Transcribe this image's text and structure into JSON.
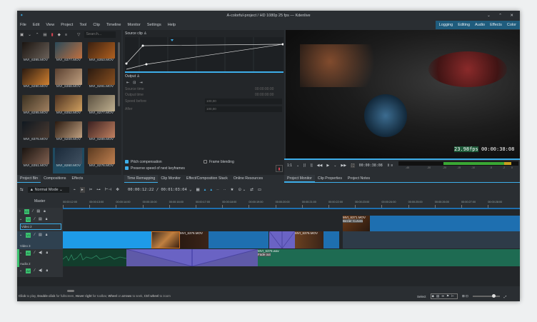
{
  "window": {
    "title": "A-colorful-project / HD 1080p 25 fps — Kdenlive"
  },
  "menu": [
    "File",
    "Edit",
    "View",
    "Project",
    "Tool",
    "Clip",
    "Timeline",
    "Monitor",
    "Settings",
    "Help"
  ],
  "workspaces": [
    "Logging",
    "Editing",
    "Audio",
    "Effects",
    "Color"
  ],
  "bin": {
    "search_placeholder": "Search...",
    "clips": [
      "MVI_6395.MOV",
      "MVI_6377.MOV",
      "MVI_6353.MOV",
      "MVI_6290.MOV",
      "MVI_6368.MOV",
      "MVI_6291.MOV",
      "MVI_6295.MOV",
      "MVI_6352.MOV",
      "MVI_6277.MOV",
      "MVI_6375.MOV",
      "MVI_6269.MOV",
      "MVI_6289.MOV",
      "MVI_6351.MOV",
      "MVI_6260.MOV",
      "MVI_6276.MOV"
    ],
    "selected": "MVI_6260.MOV"
  },
  "remap": {
    "source_clip": "Source clip",
    "output": "Output",
    "source_time_label": "Source time",
    "source_time": "00:00:00:00",
    "output_time_label": "Output time",
    "output_time": "00:00:00:00",
    "speed_before_label": "Speed before",
    "speed_before": "100,00",
    "after_label": "After",
    "after": "100,00",
    "pitch": "Pitch compensation",
    "pitch_checked": true,
    "blending": "Frame blending",
    "blending_checked": false,
    "preserve": "Preserve speed of next keyframes",
    "preserve_checked": true
  },
  "monitor": {
    "overlay_fps": "23.98fps",
    "overlay_tc": "00:00:38:08",
    "zoom": "1:1",
    "timecode": "00:00:38:08",
    "meter_ticks": [
      "-45",
      "-30",
      "-20",
      "-15",
      "-10",
      "-5",
      "-2",
      "0"
    ]
  },
  "left_tabs": [
    "Project Bin",
    "Compositions",
    "Effects"
  ],
  "mid_tabs": [
    "Time Remapping",
    "Clip Monitor",
    "Effect/Composition Stack",
    "Online Resources"
  ],
  "right_tabs": [
    "Project Monitor",
    "Clip Properties",
    "Project Notes"
  ],
  "timeline": {
    "mode": "Normal Mode",
    "position": "00:00:12:22",
    "duration": "00:01:03:04",
    "master": "Master",
    "ruler": [
      "00:00:12:00",
      "00:00:13:00",
      "00:00:14:00",
      "00:00:15:00",
      "00:00:16:00",
      "00:00:17:00",
      "00:00:18:00",
      "00:00:19:00",
      "00:00:20:00",
      "00:00:21:00",
      "00:00:22:00",
      "00:00:23:00",
      "00:00:24:00",
      "00:00:25:00",
      "00:00:26:00",
      "00:00:27:00",
      "00:00:28:00"
    ],
    "tracks": [
      {
        "tag": "V3",
        "name": ""
      },
      {
        "tag": "V2",
        "name": "Video 2"
      },
      {
        "tag": "V1",
        "name": "Video 3"
      },
      {
        "tag": "A1",
        "name": "Audio 2"
      },
      {
        "tag": "A2",
        "name": ""
      }
    ],
    "clips": {
      "v1a": "MVI_6376.MOV",
      "v1b": "MVI_6376.MOV",
      "v2": "MVI_6371.MOV",
      "v2_effect": "Bezier Curves",
      "a1": "MVI_6376.wav",
      "a1_effect": "Fade out"
    }
  },
  "status": {
    "hint_parts": [
      "Click",
      " to play, ",
      "Double click",
      " for fullscreen, ",
      "Hover right",
      " for toolbar, ",
      "Wheel",
      " or ",
      "arrows",
      " to seek, ",
      "Ctrl wheel",
      " to zoom"
    ],
    "select": "Select"
  },
  "colors": {
    "accent": "#3daee9",
    "clip_blue": "#1e6fb0",
    "audio_green": "#1e6b52",
    "composition": "#6a63c4",
    "track_tag": "#3bc16f"
  }
}
